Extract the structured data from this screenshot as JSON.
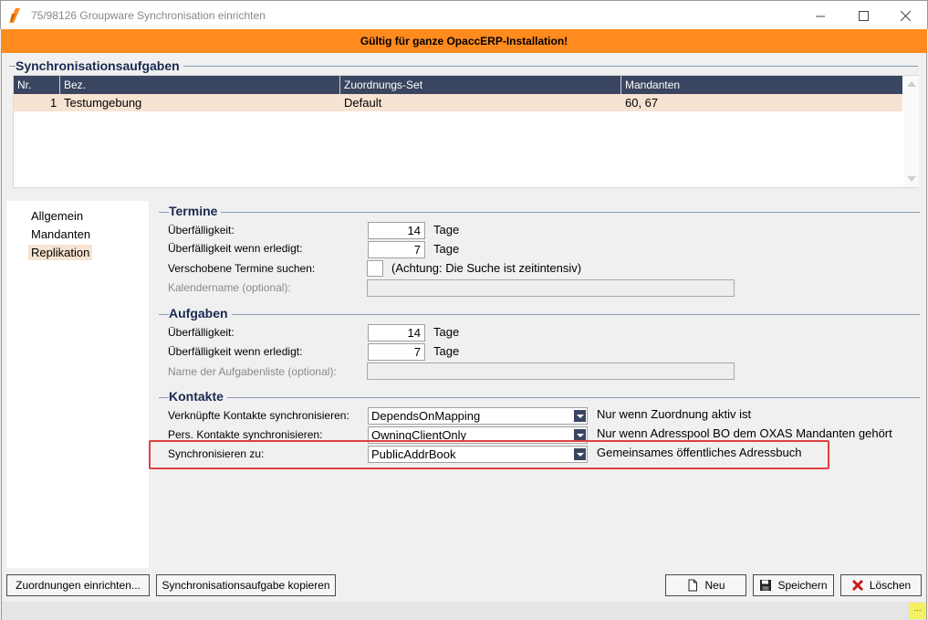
{
  "window": {
    "title": "75/98126 Groupware Synchronisation einrichten",
    "minimize_glyph": "—",
    "maximize_glyph": "☐",
    "close_glyph": "✕",
    "accent": "#ff8a1e"
  },
  "banner": {
    "text": "Gültig für ganze OpaccERP-Installation!"
  },
  "tasks": {
    "header": "Synchronisationsaufgaben",
    "columns": [
      "Nr.",
      "Bez.",
      "Zuordnungs-Set",
      "Mandanten"
    ],
    "rows": [
      {
        "nr": "1",
        "bez": "Testumgebung",
        "set": "Default",
        "mandanten": "60, 67"
      }
    ]
  },
  "nav": {
    "items": [
      {
        "label": "Allgemein",
        "active": false
      },
      {
        "label": "Mandanten",
        "active": false
      },
      {
        "label": "Replikation",
        "active": true
      }
    ]
  },
  "termine": {
    "header": "Termine",
    "overdue_label": "Überfälligkeit:",
    "overdue_value": "14",
    "overdue_unit": "Tage",
    "overdue_done_label": "Überfälligkeit wenn erledigt:",
    "overdue_done_value": "7",
    "overdue_done_unit": "Tage",
    "moved_label": "Verschobene Termine suchen:",
    "moved_checked": false,
    "moved_hint": "(Achtung: Die Suche ist zeitintensiv)",
    "calendar_label": "Kalendername (optional):",
    "calendar_value": ""
  },
  "aufgaben": {
    "header": "Aufgaben",
    "overdue_label": "Überfälligkeit:",
    "overdue_value": "14",
    "overdue_unit": "Tage",
    "overdue_done_label": "Überfälligkeit wenn erledigt:",
    "overdue_done_value": "7",
    "overdue_done_unit": "Tage",
    "tasklist_label": "Name der Aufgabenliste (optional):",
    "tasklist_value": ""
  },
  "kontakte": {
    "header": "Kontakte",
    "linked_label": "Verknüpfte Kontakte synchronisieren:",
    "linked_value": "DependsOnMapping",
    "linked_hint": "Nur wenn Zuordnung aktiv ist",
    "personal_label": "Pers. Kontakte synchronisieren:",
    "personal_value": "OwningClientOnly",
    "personal_hint": "Nur wenn Adresspool BO dem OXAS Mandanten gehört",
    "sync_to_label": "Synchronisieren zu:",
    "sync_to_value": "PublicAddrBook",
    "sync_to_hint": "Gemeinsames öffentliches Adressbuch"
  },
  "buttons": {
    "mappings": "Zuordnungen einrichten...",
    "copy": "Synchronisationsaufgabe kopieren",
    "new": "Neu",
    "save": "Speichern",
    "delete": "Löschen"
  },
  "statusbar": {
    "grip": "..."
  }
}
